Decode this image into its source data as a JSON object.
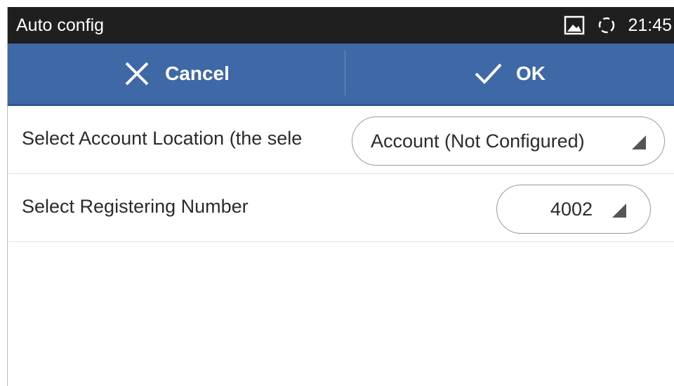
{
  "status_bar": {
    "title": "Auto config",
    "time": "21:45",
    "icons": [
      "image-icon",
      "sync-icon"
    ]
  },
  "action_bar": {
    "cancel_label": "Cancel",
    "ok_label": "OK",
    "cancel_icon": "close-icon",
    "ok_icon": "check-icon",
    "color": "#3f68a6"
  },
  "settings": {
    "account_location": {
      "label": "Select Account Location (the sele",
      "value": "Account (Not Configured)"
    },
    "registering_number": {
      "label": "Select Registering Number",
      "value": "4002"
    }
  }
}
